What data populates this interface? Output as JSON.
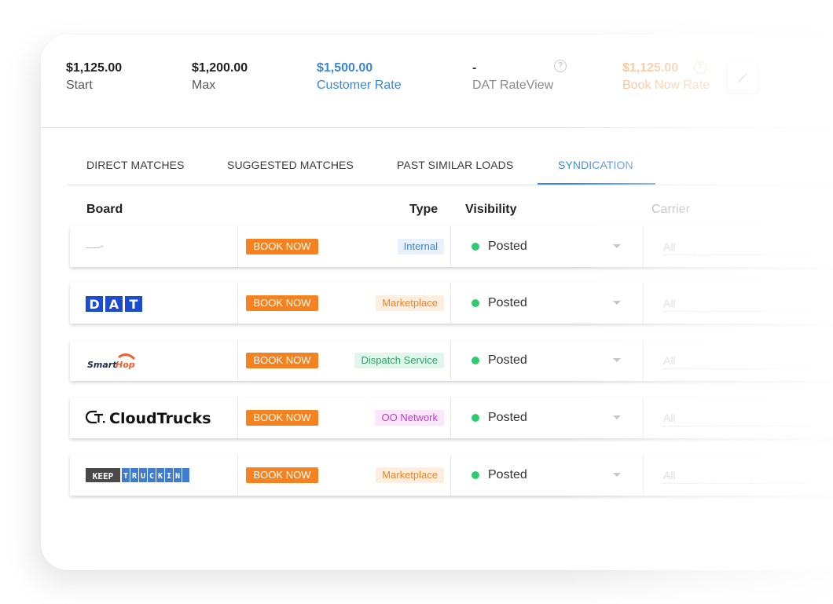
{
  "rates": {
    "start": {
      "value": "$1,125.00",
      "label": "Start"
    },
    "max": {
      "value": "$1,200.00",
      "label": "Max"
    },
    "customer": {
      "value": "$1,500.00",
      "label": "Customer Rate"
    },
    "dat": {
      "value": "-",
      "label": "DAT RateView"
    },
    "book_now": {
      "value": "$1,125.00",
      "label": "Book Now Rate"
    },
    "help_glyph": "?"
  },
  "tabs": [
    {
      "label": "DIRECT MATCHES",
      "active": false
    },
    {
      "label": "SUGGESTED MATCHES",
      "active": false
    },
    {
      "label": "PAST SIMILAR LOADS",
      "active": false
    },
    {
      "label": "SYNDICATION",
      "active": true
    }
  ],
  "table": {
    "headers": {
      "board": "Board",
      "type": "Type",
      "visibility": "Visibility",
      "carrier": "Carrier"
    },
    "rows": [
      {
        "logo": "loadsmart-icon",
        "logo_text": "Loadsmart",
        "action": "BOOK NOW",
        "type": "Internal",
        "type_color": "#3a86d8",
        "type_bg": "#e6f1fc",
        "visibility": "Posted",
        "status_color": "#2ecc71",
        "carrier": "All"
      },
      {
        "logo": "dat-logo-icon",
        "logo_text": "DAT",
        "action": "BOOK NOW",
        "type": "Marketplace",
        "type_color": "#f58220",
        "type_bg": "#fdeedf",
        "visibility": "Posted",
        "status_color": "#2ecc71",
        "carrier": "All"
      },
      {
        "logo": "smarthop-logo-icon",
        "logo_text": "SmartHop",
        "action": "BOOK NOW",
        "type": "Dispatch Service",
        "type_color": "#2ca36b",
        "type_bg": "#e3f6ec",
        "visibility": "Posted",
        "status_color": "#2ecc71",
        "carrier": "All"
      },
      {
        "logo": "cloudtrucks-logo-icon",
        "logo_text": "CloudTrucks",
        "action": "BOOK NOW",
        "type": "OO Network",
        "type_color": "#c33bcf",
        "type_bg": "#fbe6fd",
        "visibility": "Posted",
        "status_color": "#2ecc71",
        "carrier": "All"
      },
      {
        "logo": "keeptruckin-logo-icon",
        "logo_text": "KEEP TRUCKIN",
        "action": "BOOK NOW",
        "type": "Marketplace",
        "type_color": "#f58220",
        "type_bg": "#fdeedf",
        "visibility": "Posted",
        "status_color": "#2ecc71",
        "carrier": "All"
      }
    ]
  },
  "colors": {
    "accent": "#3a86d8",
    "book_now": "#f58220"
  }
}
